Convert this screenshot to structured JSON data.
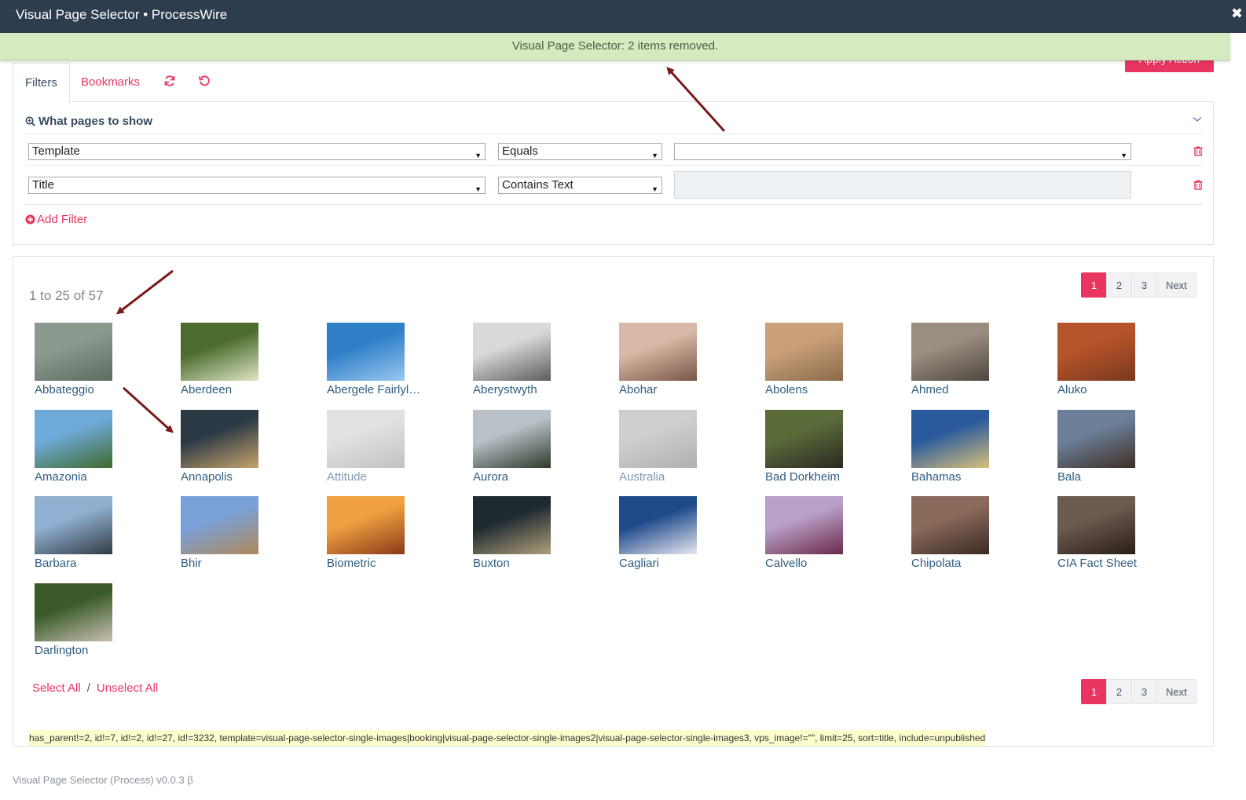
{
  "window": {
    "title": "Visual Page Selector • ProcessWire",
    "close_label": "✖"
  },
  "notice": {
    "text": "Visual Page Selector: 2 items removed."
  },
  "apply_action": {
    "label": "Apply Action"
  },
  "tabs": [
    {
      "label": "Filters",
      "active": true
    },
    {
      "label": "Bookmarks",
      "active": false
    }
  ],
  "filters": {
    "heading": "What pages to show",
    "rows": [
      {
        "field": "Template",
        "operator": "Equals",
        "value": ""
      },
      {
        "field": "Title",
        "operator": "Contains Text",
        "value": ""
      }
    ],
    "add_label": "Add Filter"
  },
  "results": {
    "count_text": "1 to 25 of 57",
    "pagination": [
      "1",
      "2",
      "3",
      "Next"
    ],
    "current_page": "1",
    "items": [
      {
        "name": "Abbateggio",
        "unpublished": false
      },
      {
        "name": "Aberdeen",
        "unpublished": false
      },
      {
        "name": "Abergele Fairlyland",
        "unpublished": false
      },
      {
        "name": "Aberystwyth",
        "unpublished": false
      },
      {
        "name": "Abohar",
        "unpublished": false
      },
      {
        "name": "Abolens",
        "unpublished": false
      },
      {
        "name": "Ahmed",
        "unpublished": false
      },
      {
        "name": "Aluko",
        "unpublished": false
      },
      {
        "name": "Amazonia",
        "unpublished": false
      },
      {
        "name": "Annapolis",
        "unpublished": false
      },
      {
        "name": "Attitude",
        "unpublished": true
      },
      {
        "name": "Aurora",
        "unpublished": false
      },
      {
        "name": "Australia",
        "unpublished": true
      },
      {
        "name": "Bad Dorkheim",
        "unpublished": false
      },
      {
        "name": "Bahamas",
        "unpublished": false
      },
      {
        "name": "Bala",
        "unpublished": false
      },
      {
        "name": "Barbara",
        "unpublished": false
      },
      {
        "name": "Bhir",
        "unpublished": false
      },
      {
        "name": "Biometric",
        "unpublished": false
      },
      {
        "name": "Buxton",
        "unpublished": false
      },
      {
        "name": "Cagliari",
        "unpublished": false
      },
      {
        "name": "Calvello",
        "unpublished": false
      },
      {
        "name": "Chipolata",
        "unpublished": false
      },
      {
        "name": "CIA Fact Sheet",
        "unpublished": false
      },
      {
        "name": "Darlington",
        "unpublished": false
      }
    ],
    "select_all": "Select All",
    "separator": "/",
    "unselect_all": "Unselect All",
    "selector": "has_parent!=2, id!=7, id!=2, id!=27, id!=3232, template=visual-page-selector-single-images|booking|visual-page-selector-single-images2|visual-page-selector-single-images3, vps_image!=\"\", limit=25, sort=title, include=unpublished"
  },
  "footer": {
    "text": "Visual Page Selector (Process) v0.0.3 β"
  },
  "colors": {
    "accent": "#e83561",
    "titlebar": "#2e3d4e",
    "notice_bg": "#d5eac0",
    "annotation_arrow": "#7a1a1a"
  },
  "icons": [
    "refresh-icon",
    "reset-icon",
    "search-zoom-icon",
    "chevron-down-icon",
    "trash-icon",
    "plus-circle-icon",
    "close-icon"
  ]
}
